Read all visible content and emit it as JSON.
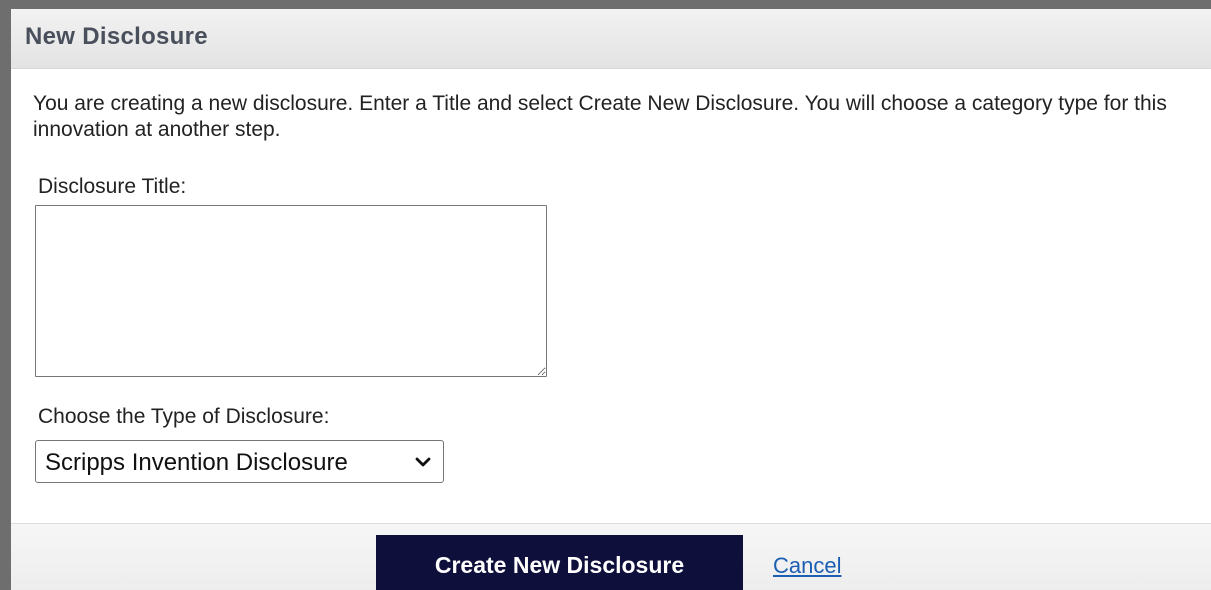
{
  "dialog": {
    "title": "New Disclosure",
    "intro_text": "You are creating a new disclosure. Enter a Title and select Create New Disclosure. You will choose a category type for this innovation at another step."
  },
  "form": {
    "title_label": "Disclosure Title:",
    "title_value": "",
    "type_label": "Choose the Type of Disclosure:",
    "type_selected": "Scripps Invention Disclosure"
  },
  "footer": {
    "create_label": "Create New Disclosure",
    "cancel_label": "Cancel"
  },
  "colors": {
    "window_border": "#6e6e6e",
    "header_bg": "#e8e8e8",
    "title_text": "#4a4f5c",
    "primary_button_bg": "#0f0f3b",
    "link": "#1a5fb4"
  },
  "icons": {
    "select_arrow": "chevron-down-icon"
  }
}
